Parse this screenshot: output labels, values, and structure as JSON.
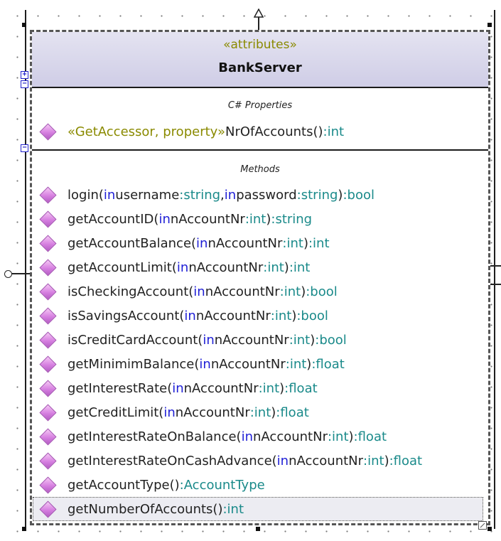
{
  "class": {
    "stereotype": "«attributes»",
    "name": "BankServer",
    "colors": {
      "header_top": "#e4e3f1",
      "header_bottom": "#cfcde6",
      "keyword": "#1f1fd6",
      "type": "#1a8a8a",
      "stereotype": "#8a8a00",
      "operation_icon": "#d67fe0"
    }
  },
  "properties_section": {
    "title": "C# Properties",
    "items": [
      {
        "stereotype": "«GetAccessor, property»",
        "name": " NrOfAccounts()",
        "type": ":int"
      }
    ]
  },
  "methods_section": {
    "title": "Methods",
    "methods": [
      {
        "name": "login(",
        "kw1": "in",
        "p1": " username",
        "t1": ":string",
        "sep": ", ",
        "kw2": "in",
        "p2": " password",
        "t2": ":string",
        "close": ")",
        "ret": ":bool"
      },
      {
        "name": "getAccountID(",
        "kw": "in",
        "param": " nAccountNr",
        "ptype": ":int",
        "close": ")",
        "ret": ":string"
      },
      {
        "name": "getAccountBalance(",
        "kw": "in",
        "param": " nAccountNr",
        "ptype": ":int",
        "close": ")",
        "ret": ":int"
      },
      {
        "name": "getAccountLimit(",
        "kw": "in",
        "param": " nAccountNr",
        "ptype": ":int",
        "close": ")",
        "ret": ":int"
      },
      {
        "name": "isCheckingAccount(",
        "kw": "in",
        "param": " nAccountNr",
        "ptype": ":int",
        "close": ")",
        "ret": ":bool"
      },
      {
        "name": "isSavingsAccount(",
        "kw": "in",
        "param": " nAccountNr",
        "ptype": ":int",
        "close": ")",
        "ret": ":bool"
      },
      {
        "name": "isCreditCardAccount(",
        "kw": "in",
        "param": " nAccountNr",
        "ptype": ":int",
        "close": ")",
        "ret": ":bool"
      },
      {
        "name": "getMinimimBalance(",
        "kw": "in",
        "param": " nAccountNr",
        "ptype": ":int",
        "close": ")",
        "ret": ":float"
      },
      {
        "name": "getInterestRate(",
        "kw": "in",
        "param": " nAccountNr",
        "ptype": ":int",
        "close": ")",
        "ret": ":float"
      },
      {
        "name": "getCreditLimit(",
        "kw": "in",
        "param": " nAccountNr",
        "ptype": ":int",
        "close": ")",
        "ret": ":float"
      },
      {
        "name": "getInterestRateOnBalance(",
        "kw": "in",
        "param": " nAccountNr",
        "ptype": ":int",
        "close": ")",
        "ret": ":float"
      },
      {
        "name": "getInterestRateOnCashAdvance(",
        "kw": "in",
        "param": " nAccountNr",
        "ptype": ":int",
        "close": ")",
        "ret": ":float"
      },
      {
        "name": "getAccountType()",
        "ret": ":AccountType"
      },
      {
        "name": "getNumberOfAccounts()",
        "ret": ":int",
        "selected": true
      }
    ]
  },
  "toggles": {
    "expand": "+",
    "collapse": "−"
  }
}
